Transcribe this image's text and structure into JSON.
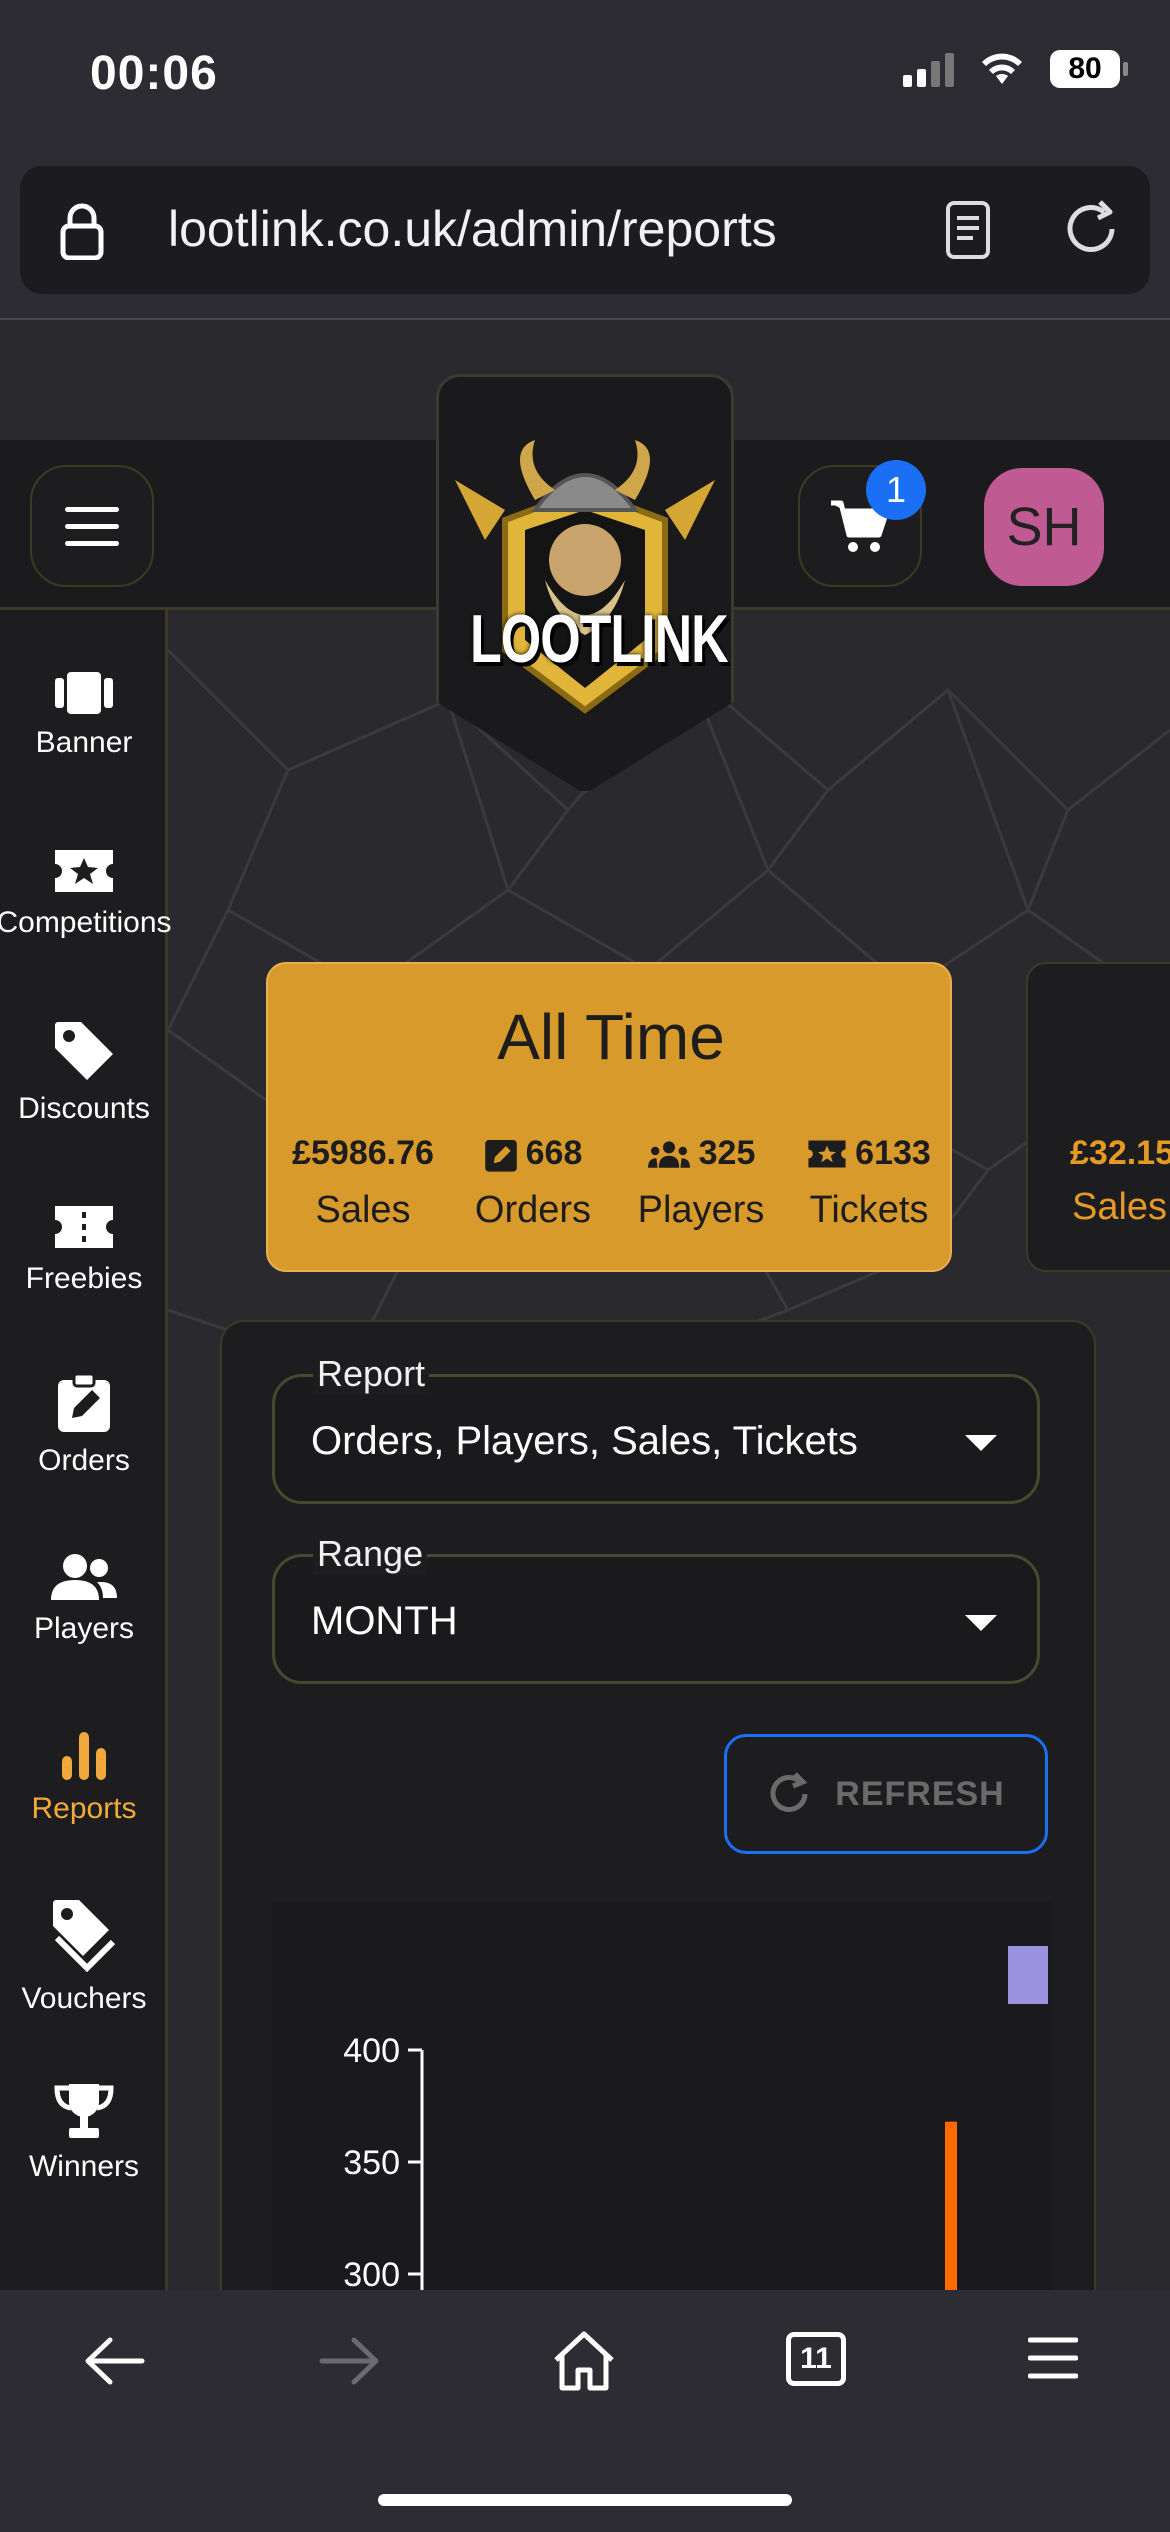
{
  "status_bar": {
    "time": "00:06",
    "battery": "80"
  },
  "browser": {
    "url": "lootlink.co.uk/admin/reports",
    "tabs_count": "11"
  },
  "header": {
    "cart_count": "1",
    "avatar_initials": "SH",
    "logo_text": "LOOTLINK"
  },
  "sidebar": {
    "items": [
      {
        "label": "Banner",
        "icon": "banner-icon"
      },
      {
        "label": "Competitions",
        "icon": "star-ticket-icon"
      },
      {
        "label": "Discounts",
        "icon": "tag-icon"
      },
      {
        "label": "Freebies",
        "icon": "ticket-icon"
      },
      {
        "label": "Orders",
        "icon": "clipboard-edit-icon"
      },
      {
        "label": "Players",
        "icon": "users-icon"
      },
      {
        "label": "Reports",
        "icon": "bar-chart-icon",
        "active": true
      },
      {
        "label": "Vouchers",
        "icon": "tags-icon"
      },
      {
        "label": "Winners",
        "icon": "trophy-icon"
      }
    ],
    "active_color": "#f2a93b"
  },
  "summary_card": {
    "title": "All Time",
    "stats": [
      {
        "value": "£5986.76",
        "label": "Sales"
      },
      {
        "value": "668",
        "label": "Orders"
      },
      {
        "value": "325",
        "label": "Players"
      },
      {
        "value": "6133",
        "label": "Tickets"
      }
    ],
    "color": "#d89a2a"
  },
  "next_card": {
    "value": "£32.15",
    "label": "Sales"
  },
  "filters": {
    "report": {
      "label": "Report",
      "value": "Orders, Players, Sales, Tickets"
    },
    "range": {
      "label": "Range",
      "value": "MONTH"
    },
    "refresh_label": "REFRESH"
  },
  "chart_data": {
    "type": "bar",
    "y_ticks": [
      "400",
      "350",
      "300"
    ],
    "series_colors": [
      "#9b93e0",
      "#ff6a00"
    ],
    "visible_bar_value": 368
  }
}
